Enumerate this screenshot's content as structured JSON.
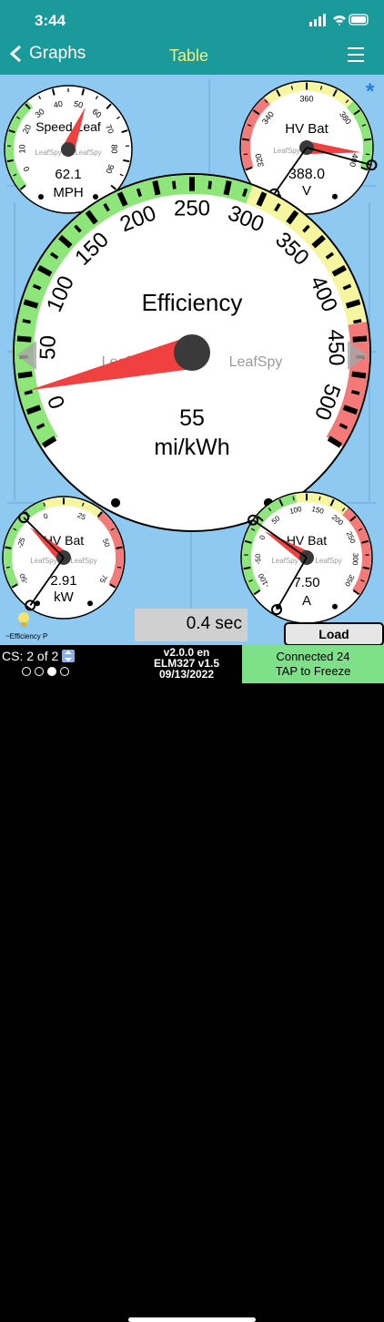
{
  "status": {
    "time": "3:44"
  },
  "nav": {
    "back_label": "Graphs",
    "center_label": "Table"
  },
  "gauges": {
    "speed": {
      "title": "Speed Leaf",
      "value": "62.1",
      "unit": "MPH",
      "ticks": [
        "0",
        "10",
        "20",
        "30",
        "40",
        "50",
        "60",
        "70",
        "80",
        "90"
      ],
      "watermark": "LeafSpy"
    },
    "hvbat": {
      "title": "HV Bat",
      "value": "388.0",
      "unit": "V",
      "ticks": [
        "320",
        "340",
        "360",
        "380",
        "400"
      ],
      "watermark": "LeafSpy"
    },
    "efficiency": {
      "title": "Efficiency",
      "value": "55",
      "unit": "mi/kWh",
      "ticks": [
        "0",
        "50",
        "100",
        "150",
        "200",
        "250",
        "300",
        "350",
        "400",
        "450",
        "500"
      ],
      "watermark": "LeafSpy"
    },
    "power": {
      "title": "HV Bat",
      "value": "2.91",
      "unit": "kW",
      "ticks": [
        "-50",
        "-25",
        "0",
        "25",
        "50",
        "75"
      ],
      "watermark": "LeafSpy"
    },
    "current": {
      "title": "HV Bat",
      "value": "7.50",
      "unit": "A",
      "ticks": [
        "-100",
        "-50",
        "0",
        "50",
        "100",
        "150",
        "200",
        "250",
        "300",
        "350"
      ],
      "watermark": "LeafSpy"
    }
  },
  "footer": {
    "time_display": "0.4 sec",
    "load_label": "Load",
    "efficiency_label": "~Efficiency P",
    "cs_label": "CS: 2 of 2",
    "version_line1": "v2.0.0 en",
    "version_line2": "ELM327 v1.5",
    "version_line3": "09/13/2022",
    "connected_line1": "Connected 24",
    "connected_line2": "TAP to Freeze"
  },
  "colors": {
    "teal": "#1a9a9a",
    "sky": "#8ec9f2",
    "green": "#8ee67a",
    "yellow": "#f6f6a0",
    "red": "#f47a7a",
    "needle": "#f04040"
  }
}
